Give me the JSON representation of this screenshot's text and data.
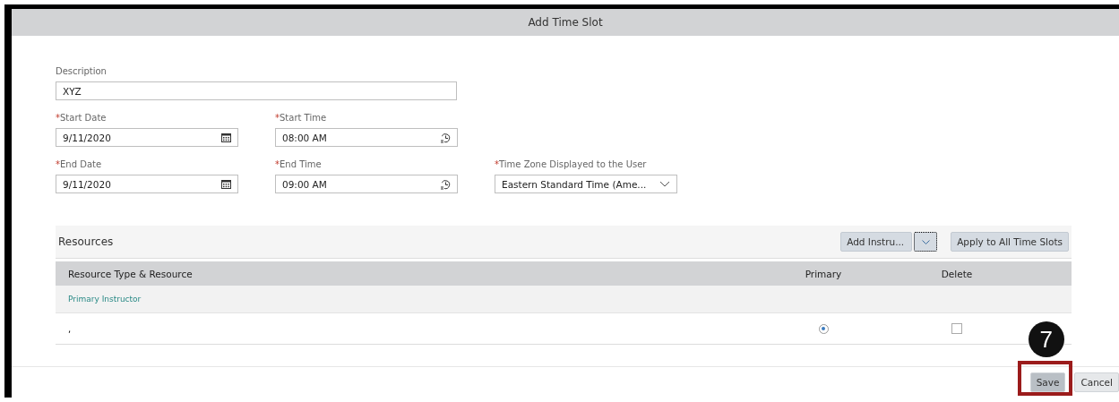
{
  "dialog": {
    "title": "Add Time Slot"
  },
  "fields": [
    {
      "label": "Description",
      "required": false,
      "value": "XYZ",
      "kind": "text"
    },
    {
      "label": "Start Date",
      "required": true,
      "value": "9/11/2020",
      "kind": "date"
    },
    {
      "label": "Start Time",
      "required": true,
      "value": "08:00 AM",
      "kind": "time"
    },
    {
      "label": "End Date",
      "required": true,
      "value": "9/11/2020",
      "kind": "date"
    },
    {
      "label": "End Time",
      "required": true,
      "value": "09:00 AM",
      "kind": "time"
    },
    {
      "label": "Time Zone Displayed to the User",
      "required": true,
      "value": "Eastern Standard Time (Ame...",
      "kind": "select"
    }
  ],
  "resources": {
    "title": "Resources",
    "add_button": "Add Instru...",
    "apply_button": "Apply to All Time Slots",
    "table": {
      "columns": [
        "Resource Type & Resource",
        "Primary",
        "Delete"
      ],
      "group": "Primary Instructor",
      "rows": [
        {
          "resource": ",",
          "primary": {
            "selected": true
          },
          "delete": {
            "checked": false
          }
        }
      ]
    }
  },
  "footer": {
    "buttons": [
      {
        "label": "Save",
        "highlighted": true
      },
      {
        "label": "Cancel",
        "highlighted": false
      }
    ]
  },
  "callout": {
    "step": "7"
  },
  "required_mark": "*"
}
